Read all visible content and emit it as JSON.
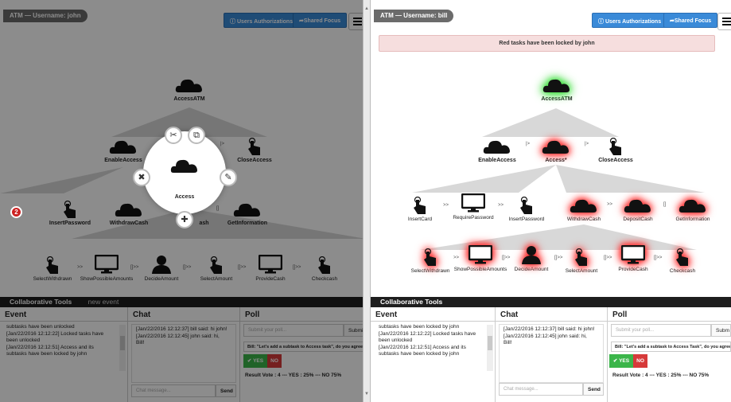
{
  "left": {
    "title": "ATM — Username: john",
    "btn_auth": "Users Authorizations",
    "btn_focus": "Shared Focus",
    "nodes": {
      "root": "AccessATM",
      "enable": "EnableAccess",
      "close": "CloseAccess",
      "insertPassword": "InsertPassword",
      "withdraw": "WithdrawCash",
      "deposit_partial": "D",
      "deposit_tail": "ash",
      "getInfo": "GetInformation",
      "selectWithdrawn": "SelectWithdrawn",
      "showAmounts": "ShowPossibleAmounts",
      "decide": "DecideAmount",
      "selectAmount": "SelectAmount",
      "provide": "ProvideCash",
      "checkcash": "Checkcash"
    },
    "radial_label": "Access",
    "badge": "2",
    "collab_title": "Collaborative Tools",
    "new_event": "new event",
    "event_header": "Event",
    "chat_header": "Chat",
    "poll_header": "Poll",
    "events": [
      "subtasks have been unlocked",
      "[Jan/22/2016 12:12:22] Locked tasks have",
      "been unlocked",
      "[Jan/22/2016 12:12:51] Access and its",
      "subtasks have been locked by john"
    ],
    "chat": [
      "[Jan/22/2016 12:12:37] bill said: hi john!",
      "[Jan/22/2016 12:12:45] john said: hi,",
      "Bill!"
    ],
    "chat_placeholder": "Chat message...",
    "send": "Send",
    "poll_placeholder": "Submit your poll...",
    "poll_submit": "Submi",
    "poll_question": "Bill: \"Let's add a subtask to Access task\", do you agree?",
    "yes": "YES",
    "no": "NO",
    "result": "Result Vote : 4 --- YES : 25% --- NO 75%"
  },
  "right": {
    "title": "ATM — Username: bill",
    "btn_auth": "Users Authorizations",
    "btn_focus": "Shared Focus",
    "lock_message": "Red tasks have been locked by john",
    "nodes": {
      "root": "AccessATM",
      "enable": "EnableAccess",
      "access": "Access*",
      "close": "CloseAccess",
      "insertCard": "InsertCard",
      "requirePassword": "RequirePassword",
      "insertPassword": "InsertPassword",
      "withdraw": "WithdrawCash",
      "deposit": "DepositCash",
      "getInfo": "GetInformation",
      "selectWithdrawn": "SelectWithdrawn",
      "showAmounts": "ShowPossibleAmounts",
      "decide": "DecideAmount",
      "selectAmount": "SelectAmount",
      "provide": "ProvideCash",
      "checkcash": "Checkcash"
    },
    "collab_title": "Collaborative Tools",
    "event_header": "Event",
    "chat_header": "Chat",
    "poll_header": "Poll",
    "events": [
      "subtasks have been locked by john",
      "[Jan/22/2016 12:12:22] Locked tasks have",
      "been unlocked",
      "[Jan/22/2016 12:12:51] Access and its",
      "subtasks have been locked by john"
    ],
    "chat": [
      "[Jan/22/2016 12:12:37] bill said: hi john!",
      "[Jan/22/2016 12:12:45] john said: hi,",
      "Bill!"
    ],
    "chat_placeholder": "Chat message...",
    "send": "Send",
    "poll_placeholder": "Submit your poll...",
    "poll_submit": "Subm",
    "poll_question": "Bill: \"Let's add a subtask to Access Task\", do you agree?",
    "yes": "YES",
    "no": "NO",
    "result": "Result Vote : 4 --- YES : 25% --- NO 75%"
  },
  "operators": {
    "enable": ">>",
    "choice": "[]",
    "seq": "|>",
    "suspend": "[]>>"
  },
  "icons": [
    "cloud-icon",
    "hand-pointer-icon",
    "monitor-icon",
    "user-icon",
    "scissors-icon",
    "copy-icon",
    "close-icon",
    "pencil-icon",
    "plus-icon",
    "info-icon",
    "share-icon",
    "menu-icon"
  ],
  "colors": {
    "accent": "#3a8ad8",
    "yes": "#3bb54a",
    "no": "#d63a3a",
    "lock_bg": "#f6dede",
    "glow_green": "#3adf3a",
    "glow_red": "#ff3030"
  }
}
